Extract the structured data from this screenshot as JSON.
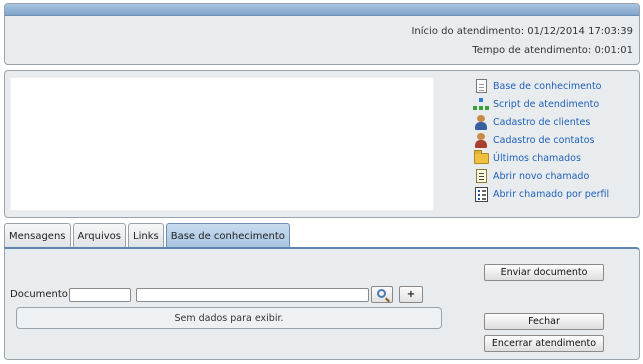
{
  "header": {
    "start_label": "Início do atendimento:",
    "start_value": "01/12/2014 17:03:39",
    "elapsed_label": "Tempo de atendimento:",
    "elapsed_value": "0:01:01"
  },
  "shortcuts": [
    {
      "label": "Base de conhecimento",
      "icon": "document-icon"
    },
    {
      "label": "Script de atendimento",
      "icon": "hierarchy-icon"
    },
    {
      "label": "Cadastro de clientes",
      "icon": "user-icon"
    },
    {
      "label": "Cadastro de contatos",
      "icon": "contact-icon"
    },
    {
      "label": "Últimos chamados",
      "icon": "folder-open-icon"
    },
    {
      "label": "Abrir novo chamado",
      "icon": "note-icon"
    },
    {
      "label": "Abrir chamado por perfil",
      "icon": "list-icon"
    }
  ],
  "tabs": [
    {
      "label": "Mensagens"
    },
    {
      "label": "Arquivos"
    },
    {
      "label": "Links"
    },
    {
      "label": "Base de conhecimento",
      "active": true
    }
  ],
  "document_form": {
    "label": "Documento:",
    "code_value": "",
    "name_value": "",
    "add_label": "+",
    "empty_message": "Sem dados para exibir."
  },
  "actions": {
    "send_document": "Enviar documento",
    "close": "Fechar",
    "end_service": "Encerrar atendimento"
  },
  "colors": {
    "header_bar": "#7fa3c8",
    "link": "#1f5fb8",
    "active_tab": "#a6c3e0",
    "panel_bg": "#e9ecee"
  }
}
